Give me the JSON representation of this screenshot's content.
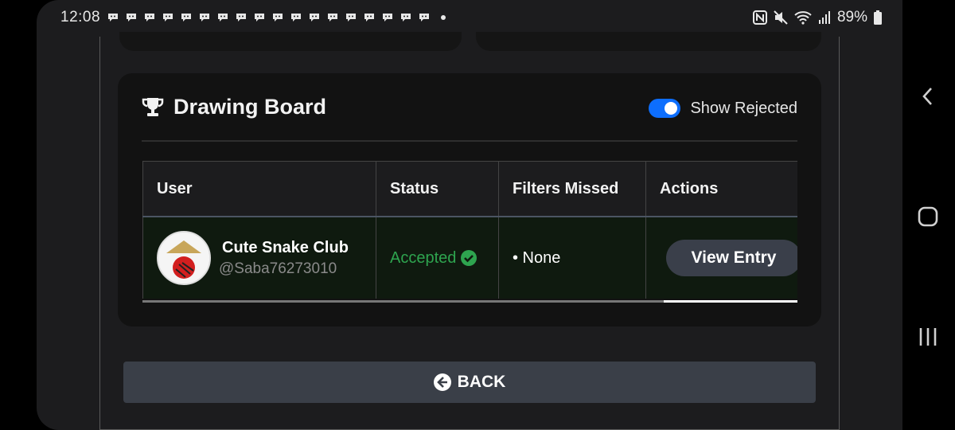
{
  "status_bar": {
    "time": "12:08",
    "notification_icon": "chat-bubble-icon",
    "notification_count": 18,
    "battery": "89%"
  },
  "card": {
    "title": "Drawing Board",
    "title_icon": "trophy-icon",
    "toggle_label": "Show Rejected",
    "toggle_on": true
  },
  "table": {
    "headers": [
      "User",
      "Status",
      "Filters Missed",
      "Actions"
    ],
    "rows": [
      {
        "name": "Cute Snake Club",
        "handle": "@Saba76273010",
        "status": "Accepted",
        "filters_missed": "• None",
        "action": "View Entry"
      }
    ]
  },
  "back_button": {
    "label": "BACK"
  },
  "colors": {
    "accent": "#0d6efd",
    "accepted": "#2ea44f"
  }
}
